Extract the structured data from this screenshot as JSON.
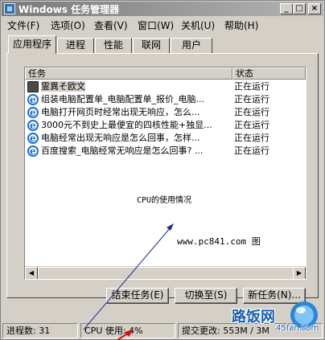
{
  "window": {
    "title": "Windows 任务管理器",
    "min_glyph": "_",
    "max_glyph": "□",
    "close_glyph": "×"
  },
  "menu": [
    "文件(F)",
    "选项(O)",
    "查看(V)",
    "窗口(W)",
    "关机(U)",
    "帮助(H)"
  ],
  "tabs": [
    {
      "label": "应用程序",
      "active": true
    },
    {
      "label": "进程",
      "active": false
    },
    {
      "label": "性能",
      "active": false
    },
    {
      "label": "联网",
      "active": false
    },
    {
      "label": "用户",
      "active": false
    }
  ],
  "list": {
    "col_task": "任务",
    "col_status": "状态",
    "rows": [
      {
        "name": "霊異そ欧文",
        "status": "正在运行",
        "icon": "folder-icon"
      },
      {
        "name": "组装电脑配置单_电脑配置单_报价_电脑...",
        "status": "正在运行",
        "icon": "ie-icon"
      },
      {
        "name": "电脑打开网页时经常出现无响应，怎么...",
        "status": "正在运行",
        "icon": "ie-icon"
      },
      {
        "name": "3000元不到史上最便宜的四核性能+独显...",
        "status": "正在运行",
        "icon": "ie-icon"
      },
      {
        "name": "电脑经常出现无响应是怎么回事，怎样...",
        "status": "正在运行",
        "icon": "ie-icon"
      },
      {
        "name": "百度搜索_电脑经常无响应是怎么回事? ...",
        "status": "正在运行",
        "icon": "ie-icon"
      }
    ],
    "annotation": "CPU的使用情况",
    "watermark_url": "www.pc841.com 图"
  },
  "buttons": {
    "end_task": "结束任务(E)",
    "switch_to": "切换至(S)",
    "new_task": "新任务(N)..."
  },
  "status": {
    "processes": "进程数: 31",
    "cpu": "CPU 使用: 4%",
    "commit": "提交更改: 553M / 3M"
  },
  "logo": {
    "text": "路饭网",
    "sub": "45fan.com"
  },
  "colors": {
    "annotation_arrow": "#1e2a8c",
    "red_arrow": "#d01010",
    "logo_blue": "#1a5fb0"
  }
}
